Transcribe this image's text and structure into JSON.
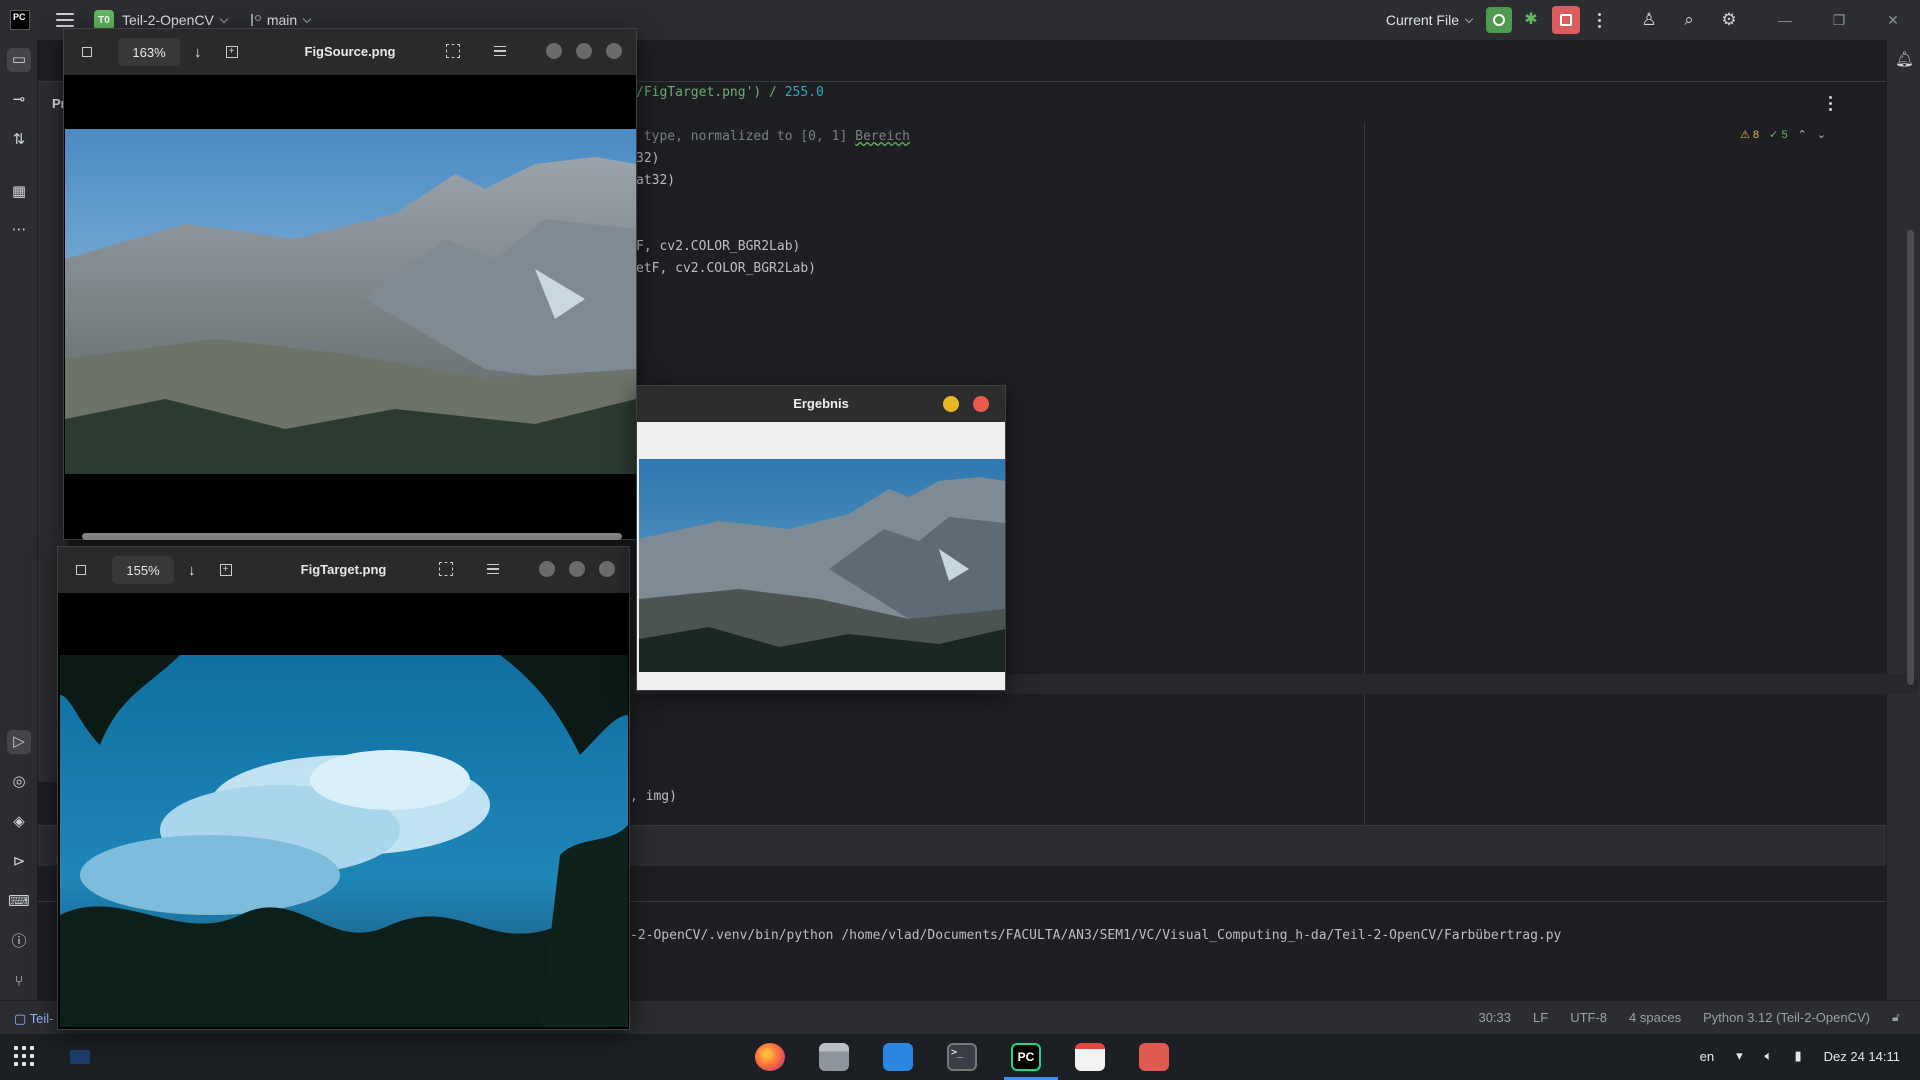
{
  "ide": {
    "logo_text": "PC",
    "project_badge": "T0",
    "project_name": "Teil-2-OpenCV",
    "branch": "main",
    "run_config": "Current File"
  },
  "editor": {
    "project_panel_label": "Pr",
    "code_lines": [
      {
        "plain": "/FigTarget.png') / ",
        "num": "255.0"
      },
      {
        "comment": " type, normalized to [0, 1] ",
        "underlined": "Bereich"
      },
      {
        "plain": "32)"
      },
      {
        "plain": "at32)"
      },
      {
        "plain": "F, cv2.COLOR_BGR2Lab)"
      },
      {
        "plain": "etF, cv2.COLOR_BGR2Lab)"
      },
      {
        "plain": ", img)"
      }
    ],
    "inspections": {
      "warnings": "8",
      "ok": "5"
    }
  },
  "run_panel": {
    "command": "-2-OpenCV/.venv/bin/python /home/vlad/Documents/FACULTA/AN3/SEM1/VC/Visual_Computing_h-da/Teil-2-OpenCV/Farbübertrag.py"
  },
  "statusbar": {
    "breadcrumb": "Teil-",
    "position": "30:33",
    "line_sep": "LF",
    "encoding": "UTF-8",
    "indent": "4 spaces",
    "interpreter": "Python 3.12 (Teil-2-OpenCV)"
  },
  "viewers": {
    "source": {
      "title": "FigSource.png",
      "zoom": "163%"
    },
    "target": {
      "title": "FigTarget.png",
      "zoom": "155%"
    }
  },
  "result_window": {
    "title": "Ergebnis"
  },
  "taskbar": {
    "language": "en",
    "clock": "Dez 24  14:11",
    "dock_apps": [
      "firefox-icon",
      "files-icon",
      "store-icon",
      "terminal-icon",
      "pycharm-icon",
      "document-viewer-icon",
      "screenshot-icon"
    ]
  }
}
